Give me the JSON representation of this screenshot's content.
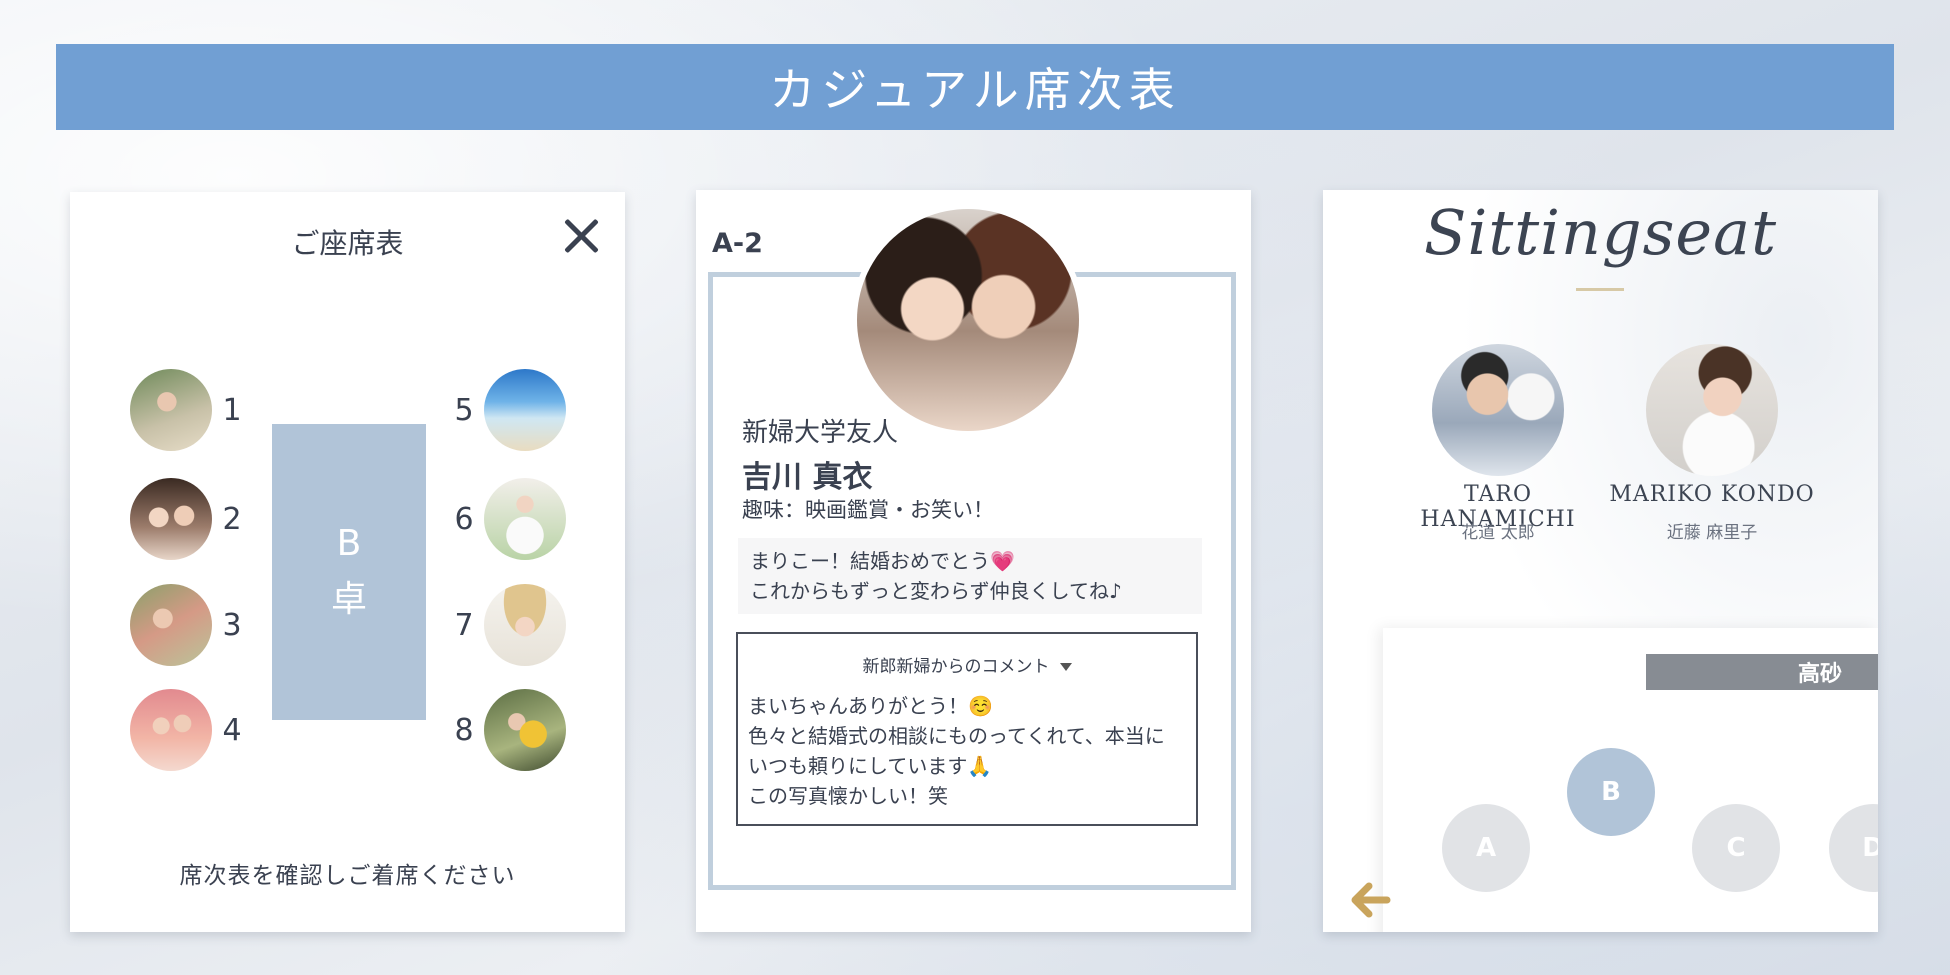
{
  "banner": {
    "title": "カジュアル席次表"
  },
  "seating_card": {
    "title": "ご座席表",
    "table_label_line1": "B",
    "table_label_line2": "卓",
    "seats": [
      {
        "number": "1"
      },
      {
        "number": "2"
      },
      {
        "number": "3"
      },
      {
        "number": "4"
      },
      {
        "number": "5"
      },
      {
        "number": "6"
      },
      {
        "number": "7"
      },
      {
        "number": "8"
      }
    ],
    "footer": "席次表を確認しご着席ください"
  },
  "profile_card": {
    "seat_code": "A-2",
    "relation": "新婦大学友人",
    "name": "吉川 真衣",
    "hobby": "趣味：映画鑑賞・お笑い！",
    "message_lines": [
      "まりこー！結婚おめでとう💗",
      "これからもずっと変わらず仲良くしてね♪"
    ],
    "comment_title": "新郎新婦からのコメント",
    "comment_lines": [
      "まいちゃんありがとう！☺️",
      "色々と結婚式の相談にものってくれて、本当に",
      "いつも頼りにしています🙏",
      "この写真懐かしい！笑"
    ]
  },
  "sitting_card": {
    "title": "Sittingseat",
    "groom": {
      "name_en": "TARO HANAMICHI",
      "name_jp": "花道 太郎"
    },
    "bride": {
      "name_en": "MARIKO KONDO",
      "name_jp": "近藤 麻里子"
    },
    "head_table": "高砂",
    "tables": [
      "A",
      "B",
      "C",
      "D"
    ]
  },
  "colors": {
    "banner": "#719fd3",
    "table_blue": "#b1c4d8",
    "table_gray": "#e1e3e6",
    "takasago_bar": "#878c93",
    "gold": "#c9a45c",
    "text": "#3a4150"
  }
}
